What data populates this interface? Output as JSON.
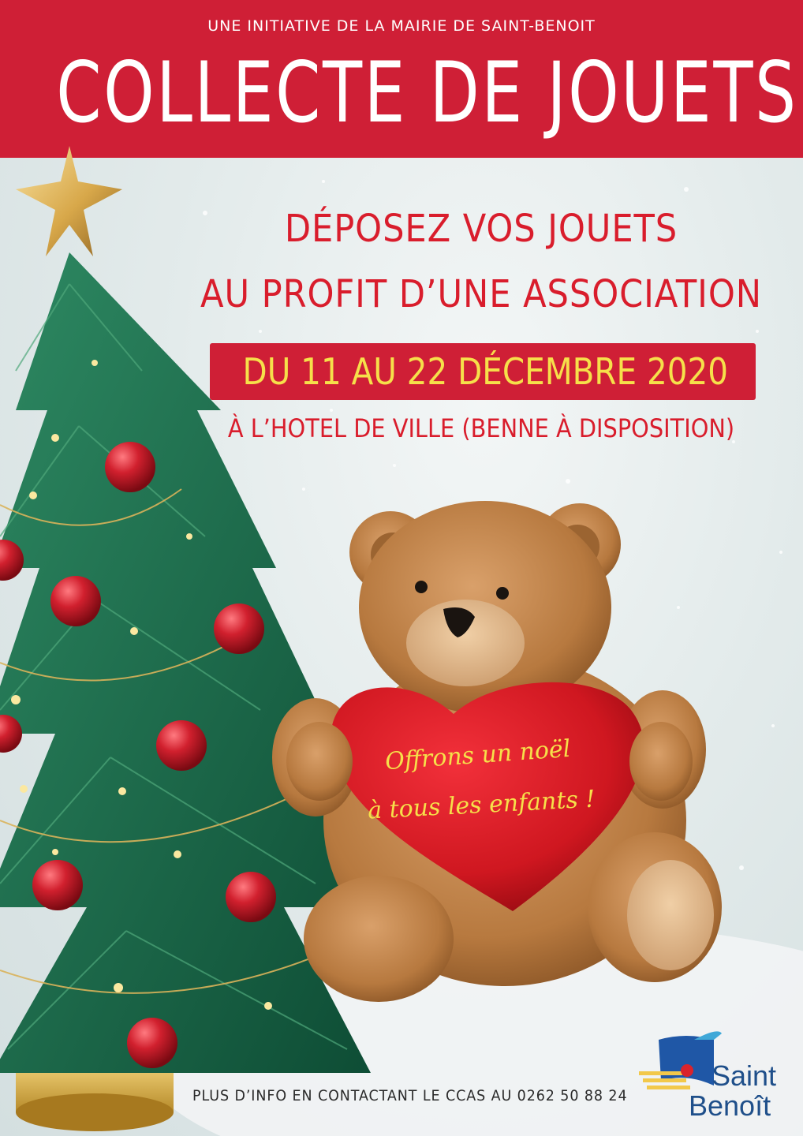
{
  "header": {
    "initiative": "UNE INITIATIVE DE LA MAIRIE DE SAINT-BENOIT",
    "title": "COLLECTE DE JOUETS"
  },
  "main": {
    "headline_line1": "DÉPOSEZ VOS JOUETS",
    "headline_line2": "AU PROFIT D’UNE ASSOCIATION",
    "dates": "DU 11 AU 22 DÉCEMBRE 2020",
    "location": "À L’HOTEL DE VILLE (BENNE À DISPOSITION)"
  },
  "heart": {
    "line1": "Offrons un noël",
    "line2": "à tous les enfants !"
  },
  "footer": {
    "info": "PLUS D’INFO EN CONTACTANT LE CCAS AU 0262 50 88 24"
  },
  "logo": {
    "line1": "Saint",
    "line2": "Benoît"
  },
  "colors": {
    "brand_red": "#cf1f36",
    "accent_yellow": "#f6e04a",
    "logo_blue": "#1f4f8a"
  },
  "icons": [
    "christmas-tree-icon",
    "gold-star-icon",
    "teddy-bear-icon",
    "heart-icon",
    "saint-benoit-logo-icon"
  ]
}
